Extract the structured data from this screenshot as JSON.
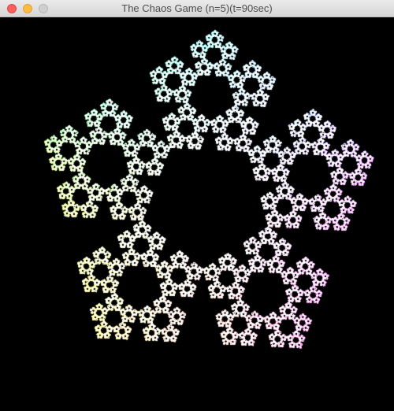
{
  "window": {
    "title": "The Chaos Game (n=5)(t=90sec)"
  },
  "fractal": {
    "type": "chaos-game",
    "vertices": 5,
    "background": "#000000",
    "vertex_colors": [
      "#3ec9e6",
      "#8a3bff",
      "#ff3fa0",
      "#f2c531",
      "#4fe62f"
    ]
  }
}
